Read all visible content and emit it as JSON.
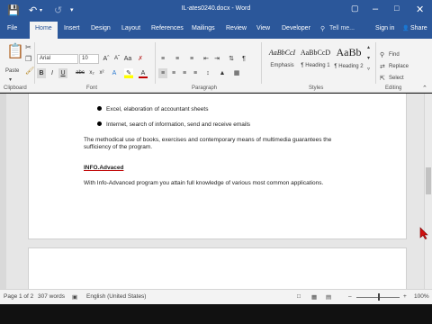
{
  "app": {
    "title": "IL-ates0240.docx - Word"
  },
  "titlebar": {
    "save_icon": "save-icon",
    "undo_icon": "undo-icon",
    "redo_icon": "redo-icon",
    "customize_icon": "customize-quick-access-icon",
    "ribbon_options_icon": "ribbon-display-options-icon",
    "minimize_icon": "minimize-icon",
    "maximize_icon": "maximize-icon",
    "close_icon": "close-icon"
  },
  "tabs": [
    {
      "label": "File"
    },
    {
      "label": "Home"
    },
    {
      "label": "Insert"
    },
    {
      "label": "Design"
    },
    {
      "label": "Layout"
    },
    {
      "label": "References"
    },
    {
      "label": "Mailings"
    },
    {
      "label": "Review"
    },
    {
      "label": "View"
    },
    {
      "label": "Developer"
    }
  ],
  "tellme": "Tell me...",
  "signin": "Sign in",
  "share": "Share",
  "ribbon": {
    "paste": "Paste",
    "font_name": "Arial",
    "font_size": "10",
    "groups": {
      "clipboard": "Clipboard",
      "font": "Font",
      "paragraph": "Paragraph",
      "styles": "Styles",
      "editing": "Editing"
    },
    "styles": [
      {
        "sample": "AaBbCcI",
        "name": "Emphasis"
      },
      {
        "sample": "AaBbCcD",
        "name": "¶ Heading 1"
      },
      {
        "sample": "AaBb",
        "name": "¶ Heading 2"
      }
    ],
    "editing": {
      "find": "Find",
      "replace": "Replace",
      "select": "Select"
    }
  },
  "document": {
    "bullets": [
      "Excel, elaboration of  accountant sheets",
      "Internet, search of information, send and receive emails"
    ],
    "para1_line1": "The methodical use of books, exercises and contemporary means of multimedia guarantees the",
    "para1_line2": "sufficiency of the program.",
    "heading": "INFO.Advaced",
    "para2": "With Info-Advanced program you attain full knowledge of various most common applications."
  },
  "status": {
    "page": "Page 1 of 2",
    "words": "307 words",
    "language": "English (United States)",
    "zoom": "100%"
  },
  "colors": {
    "brand": "#2b579a",
    "ribbon": "#f3f3f3",
    "spell_error": "#c00000"
  }
}
